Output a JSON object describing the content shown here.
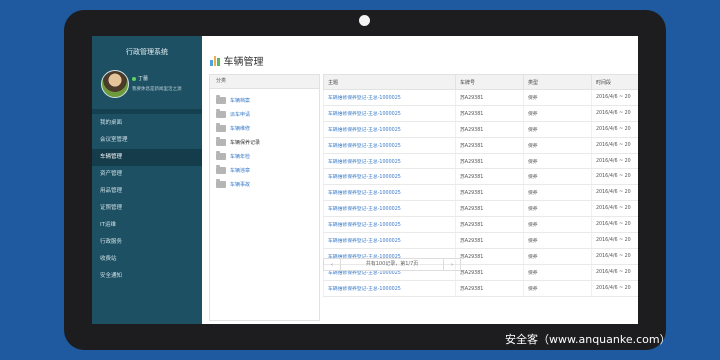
{
  "sidebar": {
    "app_title": "行政管理系统",
    "user": {
      "name": "丁蕾",
      "message": "我要休息是新闻里活之源"
    },
    "menu": [
      "我的桌面",
      "会议室管理",
      "车辆管理",
      "资产管理",
      "用品管理",
      "证照管理",
      "IT运维",
      "行政服务",
      "收费站",
      "安全通知"
    ]
  },
  "page": {
    "title": "车辆管理"
  },
  "folders": {
    "header": "分类",
    "items": [
      "车辆档案",
      "派车申请",
      "车辆维修",
      "车辆保养记录",
      "车辆年检",
      "车辆违章",
      "车辆事故"
    ]
  },
  "table": {
    "columns": [
      "主题",
      "车牌号",
      "类型",
      "时间段"
    ],
    "rows": [
      [
        "车辆维修保养登记-王总-1000025",
        "苏A29381",
        "保养",
        "2016/4/6 ~ 20"
      ],
      [
        "车辆维修保养登记-王总-1000025",
        "苏A29381",
        "保养",
        "2016/4/6 ~ 20"
      ],
      [
        "车辆维修保养登记-王总-1000025",
        "苏A29381",
        "保养",
        "2016/4/6 ~ 20"
      ],
      [
        "车辆维修保养登记-王总-1000025",
        "苏A29381",
        "保养",
        "2016/4/6 ~ 20"
      ],
      [
        "车辆维修保养登记-王总-1000025",
        "苏A29381",
        "保养",
        "2016/4/6 ~ 20"
      ],
      [
        "车辆维修保养登记-王总-1000025",
        "苏A29381",
        "保养",
        "2016/4/6 ~ 20"
      ],
      [
        "车辆维修保养登记-王总-1000025",
        "苏A29381",
        "保养",
        "2016/4/6 ~ 20"
      ],
      [
        "车辆维修保养登记-王总-1000025",
        "苏A29381",
        "保养",
        "2016/4/6 ~ 20"
      ],
      [
        "车辆维修保养登记-王总-1000025",
        "苏A29381",
        "保养",
        "2016/4/6 ~ 20"
      ],
      [
        "车辆维修保养登记-王总-1000025",
        "苏A29381",
        "保养",
        "2016/4/6 ~ 20"
      ],
      [
        "车辆维修保养登记-王总-1000025",
        "苏A29381",
        "保养",
        "2016/4/6 ~ 20"
      ],
      [
        "车辆维修保养登记-王总-1000025",
        "苏A29381",
        "保养",
        "2016/4/6 ~ 20"
      ],
      [
        "车辆维修保养登记-王总-1000025",
        "苏A29381",
        "保养",
        "2016/4/6 ~ 20"
      ]
    ]
  },
  "pager": {
    "prev": "‹",
    "info": "共有100记录，第1/7页",
    "next": "›"
  },
  "watermark": "安全客（www.anquanke.com）",
  "icons": {
    "title_icon": "bar-chart-icon",
    "folder_icon": "folder-icon",
    "status_icon": "online-dot-icon"
  },
  "colors": {
    "sidebar": "#1d5063",
    "active_menu": "#143c4b",
    "link": "#3a7bc8",
    "background": "#1f5aa0"
  }
}
